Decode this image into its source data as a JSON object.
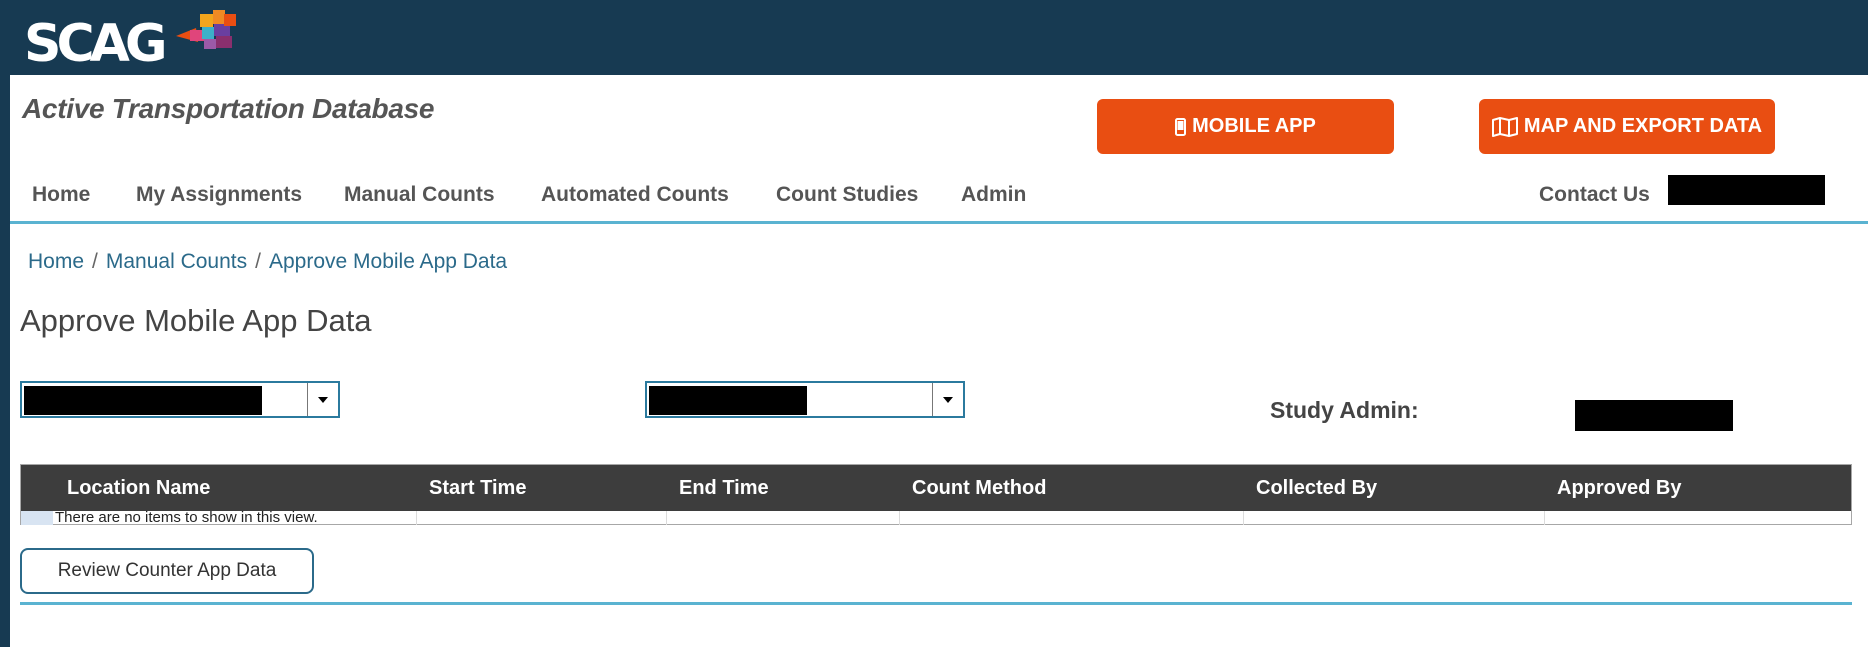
{
  "brand": {
    "logo_text": "SCAG",
    "colors": {
      "header_bg": "#173a52",
      "accent": "#e94e12",
      "divider": "#5ab3d1",
      "table_header_bg": "#3d3d3d",
      "link": "#2b6a8a"
    }
  },
  "app": {
    "title": "Active Transportation Database"
  },
  "actions": {
    "mobile_app": {
      "label": "MOBILE APP",
      "icon": "phone-icon"
    },
    "map_export": {
      "label": "MAP AND EXPORT DATA",
      "icon": "map-icon"
    }
  },
  "nav": {
    "items": [
      {
        "label": "Home"
      },
      {
        "label": "My Assignments"
      },
      {
        "label": "Manual Counts"
      },
      {
        "label": "Automated Counts"
      },
      {
        "label": "Count Studies"
      },
      {
        "label": "Admin"
      }
    ],
    "contact": "Contact Us"
  },
  "breadcrumb": {
    "items": [
      "Home",
      "Manual Counts",
      "Approve Mobile App Data"
    ],
    "separator": "/"
  },
  "page": {
    "title": "Approve Mobile App Data"
  },
  "filters": {
    "study_admin_label": "Study Admin:"
  },
  "table": {
    "columns": [
      "Location Name",
      "Start Time",
      "End Time",
      "Count Method",
      "Collected By",
      "Approved By"
    ],
    "rows": [],
    "empty_message": "There are no items to show in this view."
  },
  "buttons": {
    "review": "Review Counter App Data"
  }
}
